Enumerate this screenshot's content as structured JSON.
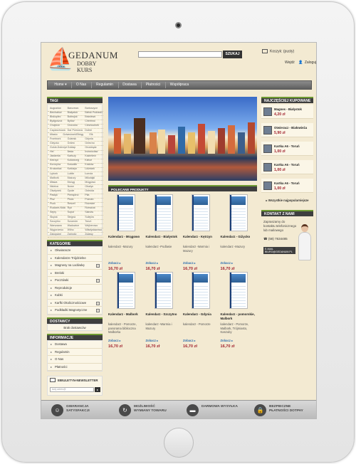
{
  "header": {
    "logo_line1": "GEDANUM",
    "logo_line2": "DOBRY KURS",
    "search_button": "SZUKAJ",
    "cart_text": "Koszyk: (pusty)",
    "login": "Wejdź",
    "register": "Zaloguj"
  },
  "nav": {
    "items": [
      "Home",
      "O Nas",
      "Regulamin",
      "Dostawa",
      "Płatności",
      "Współpraca"
    ]
  },
  "tags": {
    "title": "TAGI",
    "lines": [
      [
        "Augustów",
        "Barczewo",
        "Bartoszyce"
      ],
      [
        "Bełchatów",
        "Białystok",
        "Bielsk Podlaski"
      ],
      [
        "Biskupiec",
        "Bobrujsk",
        "Braniewo"
      ],
      [
        "Bydgoszcz",
        "Bytów",
        "Chełmno"
      ],
      [
        "Chojnice",
        "Chorzów",
        "Ciechocinek"
      ],
      [
        "Częstochowa",
        "Dar Pomorza",
        "Dobre"
      ],
      [
        "Miasto",
        "Dziwnówek",
        "Elbląg",
        "Ełk"
      ],
      [
        "Frombork",
        "Gdańsk",
        "Gdynia"
      ],
      [
        "Giżycko",
        "Gniew",
        "Gniezno"
      ],
      [
        "Golub-Dobrzyń",
        "Goldap",
        "Grudziądz"
      ],
      [
        "Hel",
        "Iława",
        "Inowrocław"
      ],
      [
        "Jastarnia",
        "Kartuzy",
        "Kazimierz"
      ],
      [
        "Ketrzyn",
        "Kołobrzeg",
        "Kielce"
      ],
      [
        "Korczyna",
        "Koszalin",
        "Kraków"
      ],
      [
        "Kruszwica",
        "Kwidzyn",
        "Lidzbark"
      ],
      [
        "Lębork",
        "Lublin",
        "Łomża"
      ],
      [
        "Malbork",
        "Mazury",
        "Mikołajki"
      ],
      [
        "Mława",
        "Morąg",
        "Mrągowo"
      ],
      [
        "Nidzica",
        "Nowe",
        "Olsztyn"
      ],
      [
        "Olsztynek",
        "Opole",
        "Ostróda"
      ],
      [
        "Pasłęk",
        "Pieniężno",
        "Piła"
      ],
      [
        "Pisz",
        "Płock",
        "Poznań"
      ],
      [
        "Puck",
        "Reszel",
        "Rozewie"
      ],
      [
        "Ruciane-Nida",
        "Ryn",
        "Rzeszów"
      ],
      [
        "Sejny",
        "Sopot",
        "Sianów"
      ],
      [
        "Słupsk",
        "Stegna",
        "Sulejów"
      ],
      [
        "Szczytno",
        "Szczecin",
        "Toruń"
      ],
      [
        "Warszawa",
        "Wadowice",
        "Wejherowo"
      ],
      [
        "Węgorzewo",
        "Wilno",
        "Władysławowo"
      ],
      [
        "Zakopane",
        "Zamość",
        "Żuławy"
      ]
    ]
  },
  "categories": {
    "title": "KATEGORIE",
    "items": [
      {
        "label": "Okwiaracze",
        "plus": false
      },
      {
        "label": "Kalendarze Trójdzielne",
        "plus": false
      },
      {
        "label": "Magnesy na Lodówkę",
        "plus": true
      },
      {
        "label": "Breloki",
        "plus": false
      },
      {
        "label": "Pocztówki",
        "plus": true
      },
      {
        "label": "Reprodukcje",
        "plus": false
      },
      {
        "label": "Kubki",
        "plus": false
      },
      {
        "label": "Karfki Okolicznościowe",
        "plus": true
      },
      {
        "label": "Podkładki Magnetyczne",
        "plus": true
      }
    ]
  },
  "suppliers": {
    "title": "DOSTAWCY",
    "text": "Brak dostawców"
  },
  "info": {
    "title": "INFORMACJE",
    "items": [
      "Dostawa",
      "Regulamin",
      "O Nas",
      "Płatności"
    ]
  },
  "newsletter": {
    "title": "EBIULETYN-NEWSLETTER",
    "placeholder": "twój adres@"
  },
  "featured": {
    "title": "POLECANE PRODUKTY",
    "more_label": "Zobacz",
    "products": [
      {
        "name": "Kalendarz - Mrągowo",
        "desc": "kalendarz -Mazury",
        "price": "16,70 zł"
      },
      {
        "name": "Kalendarz - Białystok",
        "desc": "kalendarz -Podlasie",
        "price": "16,70 zł"
      },
      {
        "name": "Kalendarz - Kętrzyn",
        "desc": "kalendarz -Warmia i Mazury",
        "price": "16,70 zł"
      },
      {
        "name": "Kalendarz - Giżycko",
        "desc": "kalendarz -Mazury",
        "price": "16,70 zł"
      },
      {
        "name": "Kalendarz - Malbork",
        "desc": "kalendarz - Pomorze, panorama biblioczna Malborka",
        "price": "16,70 zł"
      },
      {
        "name": "Kalendarz - Szczytno",
        "desc": "kalendarz -Warmia i Mazury",
        "price": "16,70 zł"
      },
      {
        "name": "Kalendarz - Gdynia",
        "desc": "kalendarz - Pomorze",
        "price": "16,70 zł"
      },
      {
        "name": "Kalendarz - pomorskie, Malbork",
        "desc": "kalendarz - Pomorze, Malbork, Trójmiasto, Kaszuby",
        "price": "16,70 zł"
      }
    ]
  },
  "bestsellers": {
    "title": "NAJCZĘŚCIEJ KUPOWANE",
    "items": [
      {
        "n": "1",
        "name": "Magnes - Białystok",
        "price": "4,20 zł"
      },
      {
        "n": "2",
        "name": "Otwieracz - Białowieża",
        "price": "5,90 zł"
      },
      {
        "n": "3",
        "name": "Kartka A6 - Toruń",
        "price": "1,00 zł"
      },
      {
        "n": "4",
        "name": "Kartka A6 - Toruń",
        "price": "1,00 zł"
      },
      {
        "n": "5",
        "name": "Kartka A6 - Toruń",
        "price": "1,00 zł"
      }
    ],
    "all_label": "Wszystkie najpopularniejsze"
  },
  "contact": {
    "title": "KONTAKT Z NAMI",
    "text": "Zapraszamy do kontaktu telefonicznego lub mailowego",
    "phone": "(58) 7634485",
    "email_label": "E-MAIL",
    "email": "BIURO@GEDANUM.PL"
  },
  "footer": {
    "features": [
      {
        "line1": "GWARANCJA",
        "line2": "SATYSFAKCJI",
        "icon": "smile-icon"
      },
      {
        "line1": "MOŻLIWOŚĆ",
        "line2": "WYMIANY TOWARU",
        "icon": "refresh-icon"
      },
      {
        "line1": "DARMOWA WYSYŁKA",
        "line2": "",
        "icon": "truck-icon"
      },
      {
        "line1": "BEZPIECZNE",
        "line2": "PŁATNOŚCI DOTPAY",
        "icon": "lock-icon"
      }
    ]
  }
}
